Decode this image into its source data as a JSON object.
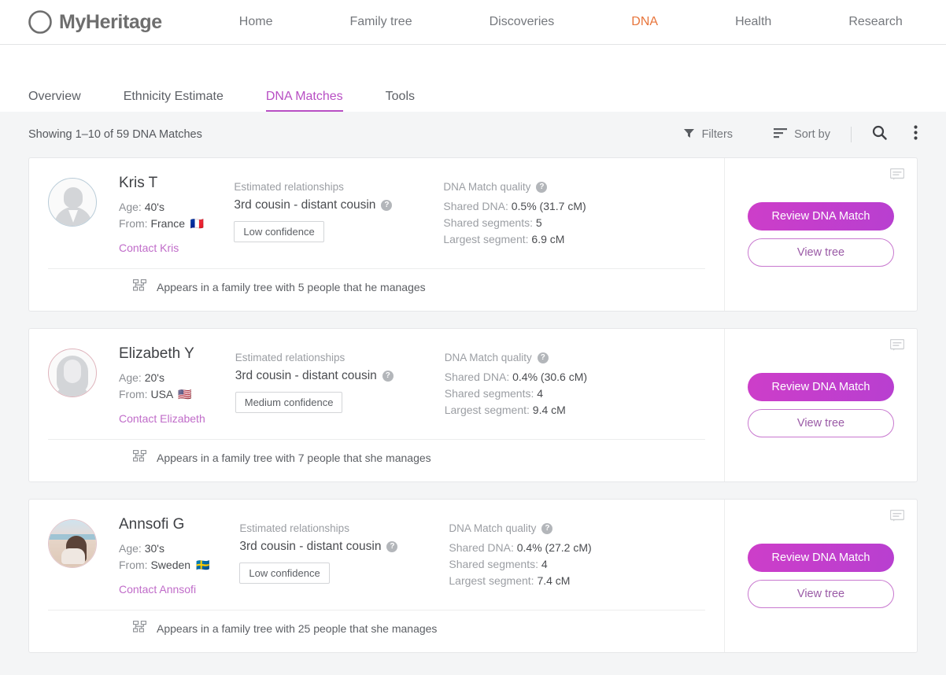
{
  "header": {
    "brand_name": "MyHeritage",
    "brand_icon": "myheritage-logo-icon",
    "nav": [
      {
        "label": "Home",
        "active": false
      },
      {
        "label": "Family tree",
        "active": false
      },
      {
        "label": "Discoveries",
        "active": false
      },
      {
        "label": "DNA",
        "active": true
      },
      {
        "label": "Health",
        "active": false
      },
      {
        "label": "Research",
        "active": false
      }
    ],
    "active_color": "#e8753b"
  },
  "subnav": {
    "tabs": [
      {
        "label": "Overview",
        "active": false
      },
      {
        "label": "Ethnicity Estimate",
        "active": false
      },
      {
        "label": "DNA Matches",
        "active": true
      },
      {
        "label": "Tools",
        "active": false
      }
    ],
    "active_color": "#b84fc4"
  },
  "toolbar": {
    "showing": "Showing 1–10 of 59 DNA Matches",
    "filters_label": "Filters",
    "filters_icon": "filter-funnel-icon",
    "sort_label": "Sort by",
    "sort_icon": "sort-lines-icon",
    "search_icon": "search-icon",
    "more_icon": "more-vertical-icon"
  },
  "labels": {
    "estimated_relationships": "Estimated relationships",
    "dna_match_quality": "DNA Match quality",
    "shared_dna": "Shared DNA:",
    "shared_segments": "Shared segments:",
    "largest_segment": "Largest segment:",
    "review_button": "Review DNA Match",
    "view_tree_button": "View tree",
    "help_icon": "question-mark-icon",
    "note_icon": "note-comment-icon",
    "tree_icon": "family-tree-icon"
  },
  "matches": [
    {
      "name": "Kris T",
      "age_label": "Age:",
      "age_value": "40's",
      "from_label": "From:",
      "from_value": "France",
      "flag": "🇫🇷",
      "contact_label": "Contact Kris",
      "avatar_type": "male",
      "relationship": "3rd cousin - distant cousin",
      "confidence": "Low confidence",
      "shared_dna": "0.5% (31.7 cM)",
      "shared_segments": "5",
      "largest_segment": "6.9 cM",
      "tree_text": "Appears in a family tree with 5 people that he manages"
    },
    {
      "name": "Elizabeth Y",
      "age_label": "Age:",
      "age_value": "20's",
      "from_label": "From:",
      "from_value": "USA",
      "flag": "🇺🇸",
      "contact_label": "Contact Elizabeth",
      "avatar_type": "female",
      "relationship": "3rd cousin - distant cousin",
      "confidence": "Medium confidence",
      "shared_dna": "0.4% (30.6 cM)",
      "shared_segments": "4",
      "largest_segment": "9.4 cM",
      "tree_text": "Appears in a family tree with 7 people that she manages"
    },
    {
      "name": "Annsofi G",
      "age_label": "Age:",
      "age_value": "30's",
      "from_label": "From:",
      "from_value": "Sweden",
      "flag": "🇸🇪",
      "contact_label": "Contact Annsofi",
      "avatar_type": "photo",
      "relationship": "3rd cousin - distant cousin",
      "confidence": "Low confidence",
      "shared_dna": "0.4% (27.2 cM)",
      "shared_segments": "4",
      "largest_segment": "7.4 cM",
      "tree_text": "Appears in a family tree with 25 people that she manages"
    }
  ]
}
